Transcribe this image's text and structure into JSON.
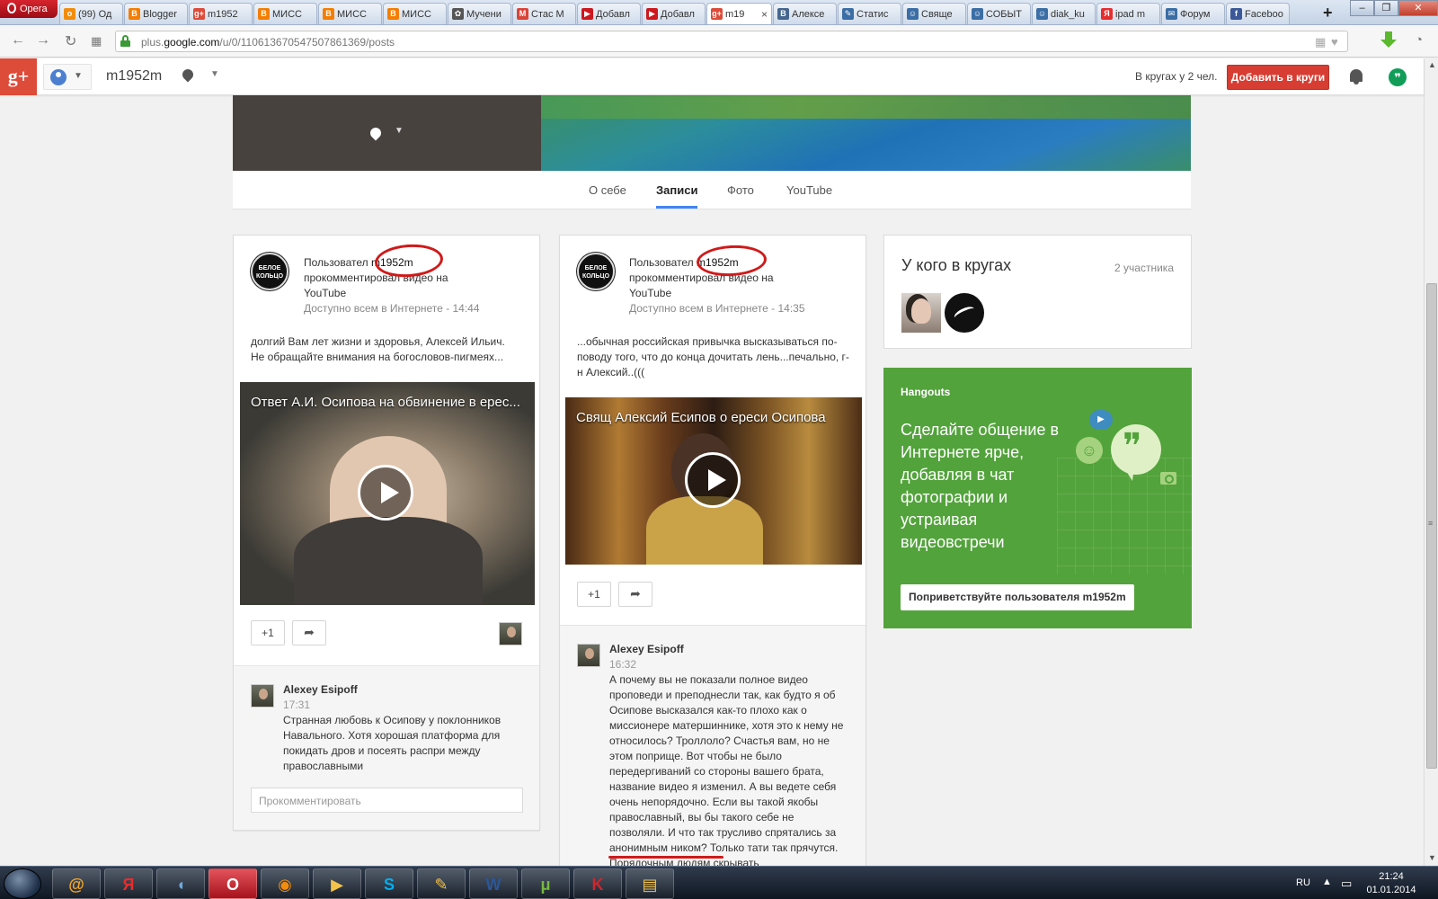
{
  "browser": {
    "menu_label": "Opera",
    "tabs": [
      {
        "label": "(99) Од",
        "color": "#f28c0c",
        "glyph": "о"
      },
      {
        "label": "Blogger",
        "color": "#f57d00",
        "glyph": "B"
      },
      {
        "label": "m1952",
        "color": "#dd4b39",
        "glyph": "g+"
      },
      {
        "label": "МИСС",
        "color": "#f57d00",
        "glyph": "B"
      },
      {
        "label": "МИСС",
        "color": "#f57d00",
        "glyph": "B"
      },
      {
        "label": "МИСС",
        "color": "#f57d00",
        "glyph": "B"
      },
      {
        "label": "Мучени",
        "color": "#555555",
        "glyph": "✿"
      },
      {
        "label": "Стас М",
        "color": "#db4437",
        "glyph": "M"
      },
      {
        "label": "Добавл",
        "color": "#cc181e",
        "glyph": "▶"
      },
      {
        "label": "Добавл",
        "color": "#cc181e",
        "glyph": "▶"
      },
      {
        "label": "m19",
        "color": "#dd4b39",
        "glyph": "g+",
        "active": true
      },
      {
        "label": "Алексе",
        "color": "#45668e",
        "glyph": "B"
      },
      {
        "label": "Статис",
        "color": "#3b6ea5",
        "glyph": "✎"
      },
      {
        "label": "Свяще",
        "color": "#3b6ea5",
        "glyph": "☺"
      },
      {
        "label": "СОБЫТ",
        "color": "#3b6ea5",
        "glyph": "☺"
      },
      {
        "label": "diak_ku",
        "color": "#3b6ea5",
        "glyph": "☺"
      },
      {
        "label": "ipad m",
        "color": "#e62d2d",
        "glyph": "Я"
      },
      {
        "label": "Форум",
        "color": "#3b6ea5",
        "glyph": "✉"
      },
      {
        "label": "Faceboo",
        "color": "#3b5998",
        "glyph": "f"
      }
    ],
    "new_tab": "+",
    "url_prefix": "plus.",
    "url_domain": "google.com",
    "url_path": "/u/0/110613670547507861369/posts"
  },
  "gplus": {
    "logo": "g+",
    "profile_name": "m1952m",
    "in_circles": "В кругах у 2 чел.",
    "add_to_circles": "Добавить в круги"
  },
  "profile_tabs": [
    "О себе",
    "Записи",
    "Фото",
    "YouTube"
  ],
  "posts": [
    {
      "logo_line1": "БЕЛОЕ",
      "logo_line2": "КОЛЬЦО",
      "head_prefix": "Пользовател",
      "user": "m1952m",
      "action": "прокомментировал видео на YouTube",
      "meta": "Доступно всем в Интернете  -  14:44",
      "text": "долгий Вам лет жизни и здоровья, Алексей Ильич. Не обращайте внимания на богословов-пигмеях...",
      "video_title": "Ответ А.И. Осипова на обвинение в ерес...",
      "plus": "+1",
      "comment": {
        "author": "Alexey Esipoff",
        "time": "17:31",
        "text": "Странная любовь к Осипову у поклонников Навального. Хотя хорошая платформа для покидать дров и посеять распри между православными"
      },
      "comment_placeholder": "Прокомментировать"
    },
    {
      "logo_line1": "БЕЛОЕ",
      "logo_line2": "КОЛЬЦО",
      "head_prefix": "Пользовател",
      "user": "m1952m",
      "action": "прокомментировал видео на YouTube",
      "meta": "Доступно всем в Интернете  -  14:35",
      "text": "...обычная российская привычка высказываться по-поводу того, что до конца дочитать лень...печально, г-н Алексий..(((",
      "video_title": "Свящ Алексий Есипов о ереси Осипова",
      "plus": "+1",
      "comment": {
        "author": "Alexey Esipoff",
        "time": "16:32",
        "text": "А почему вы не показали полное видео проповеди и преподнесли так, как будто я об Осипове высказался как-то плохо как о миссионере матершиннике, хотя это к нему не относилось? Троллоло? Счастья вам, но не этом поприще. Вот чтобы не было передергиваний со стороны вашего брата, название видео я изменил. А вы ведете себя очень непорядочно. Если вы такой якобы православный, вы бы такого себе не позволяли. И что так трусливо спрятались за анонимным ником? Только тати так прячутся. Порядочным людям скрывать"
      }
    }
  ],
  "circles_card": {
    "title": "У кого в кругах",
    "count": "2 участника"
  },
  "hangouts": {
    "label": "Hangouts",
    "description": "Сделайте общение в Интернете ярче, добавляя в чат фотографии и устраивая видеовстречи",
    "greet_button": "Поприветствуйте пользователя m1952m"
  },
  "taskbar": {
    "lang": "RU",
    "time": "21:24",
    "date": "01.01.2014",
    "apps": [
      {
        "name": "mail-agent",
        "glyph": "@",
        "color": "#f5a623"
      },
      {
        "name": "yandex",
        "glyph": "Я",
        "color": "#e62d2d"
      },
      {
        "name": "volume",
        "glyph": "◖",
        "color": "#6fa8dc"
      },
      {
        "name": "opera",
        "glyph": "O",
        "color": "#ffffff",
        "active": true
      },
      {
        "name": "firefox",
        "glyph": "◉",
        "color": "#f28c0c"
      },
      {
        "name": "media-player",
        "glyph": "▶",
        "color": "#f3c24b"
      },
      {
        "name": "skype",
        "glyph": "S",
        "color": "#00aff0"
      },
      {
        "name": "photo-editor",
        "glyph": "✎",
        "color": "#f3c24b"
      },
      {
        "name": "word",
        "glyph": "W",
        "color": "#2b5797"
      },
      {
        "name": "utorrent",
        "glyph": "μ",
        "color": "#76b83f"
      },
      {
        "name": "kaspersky",
        "glyph": "K",
        "color": "#d0262d"
      },
      {
        "name": "explorer",
        "glyph": "▤",
        "color": "#f3c24b"
      }
    ]
  }
}
